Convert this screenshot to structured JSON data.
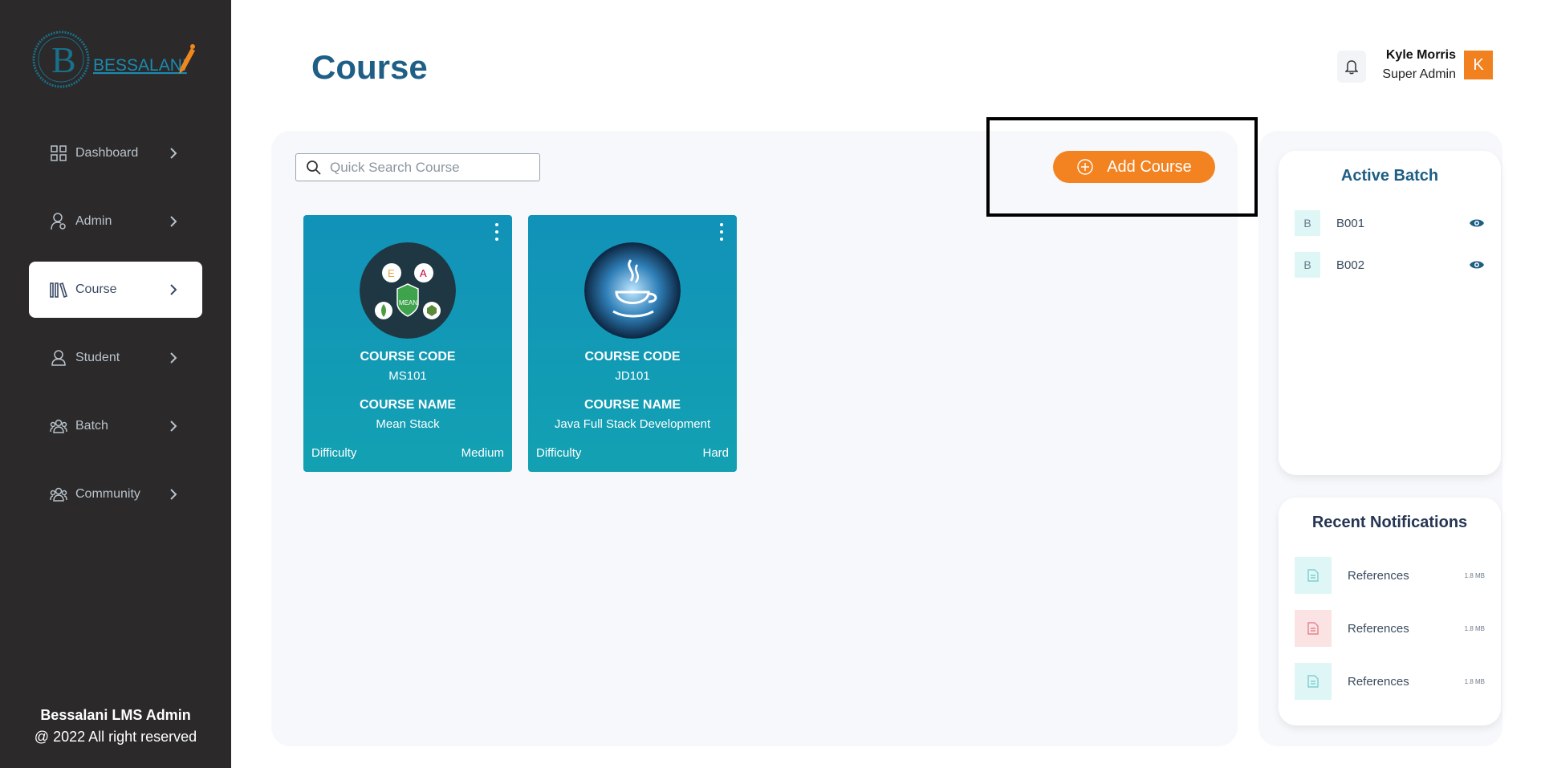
{
  "brand": {
    "logo_text": "BESSALANI",
    "logo_letter": "B"
  },
  "sidebar": {
    "items": [
      {
        "label": "Dashboard",
        "icon": "grid-icon"
      },
      {
        "label": "Admin",
        "icon": "admin-user-icon"
      },
      {
        "label": "Course",
        "icon": "books-icon",
        "active": true
      },
      {
        "label": "Student",
        "icon": "person-icon"
      },
      {
        "label": "Batch",
        "icon": "group-icon"
      },
      {
        "label": "Community",
        "icon": "community-icon"
      }
    ],
    "footer_title": "Bessalani LMS Admin",
    "footer_copyright": "@ 2022 All right reserved"
  },
  "header": {
    "title": "Course",
    "user_name": "Kyle Morris",
    "user_role": "Super Admin",
    "avatar_initial": "K"
  },
  "search": {
    "placeholder": "Quick Search Course",
    "value": ""
  },
  "add_button": {
    "label": "Add Course"
  },
  "courses": [
    {
      "code_label": "COURSE CODE",
      "code": "MS101",
      "name_label": "COURSE NAME",
      "name": "Mean Stack",
      "difficulty_label": "Difficulty",
      "difficulty": "Medium",
      "thumb_letters": {
        "e": "E",
        "a": "A",
        "mean": "MEAN"
      }
    },
    {
      "code_label": "COURSE CODE",
      "code": "JD101",
      "name_label": "COURSE NAME",
      "name": "Java Full Stack Development",
      "difficulty_label": "Difficulty",
      "difficulty": "Hard"
    }
  ],
  "active_batch": {
    "title": "Active Batch",
    "batches": [
      {
        "initial": "B",
        "name": "B001"
      },
      {
        "initial": "B",
        "name": "B002"
      }
    ]
  },
  "notifications": {
    "title": "Recent Notifications",
    "items": [
      {
        "label": "References",
        "size": "1.8 MB",
        "color": "#dff6f6",
        "icon_color": "#7fcfcf"
      },
      {
        "label": "References",
        "size": "1.8 MB",
        "color": "#fbe3e4",
        "icon_color": "#e2848c"
      },
      {
        "label": "References",
        "size": "1.8 MB",
        "color": "#dff6f6",
        "icon_color": "#7fcfcf"
      }
    ]
  },
  "colors": {
    "accent": "#f38220",
    "sidebar_bg": "#2b2929",
    "card_teal": "#1192b9",
    "title_blue": "#1f5f86"
  }
}
